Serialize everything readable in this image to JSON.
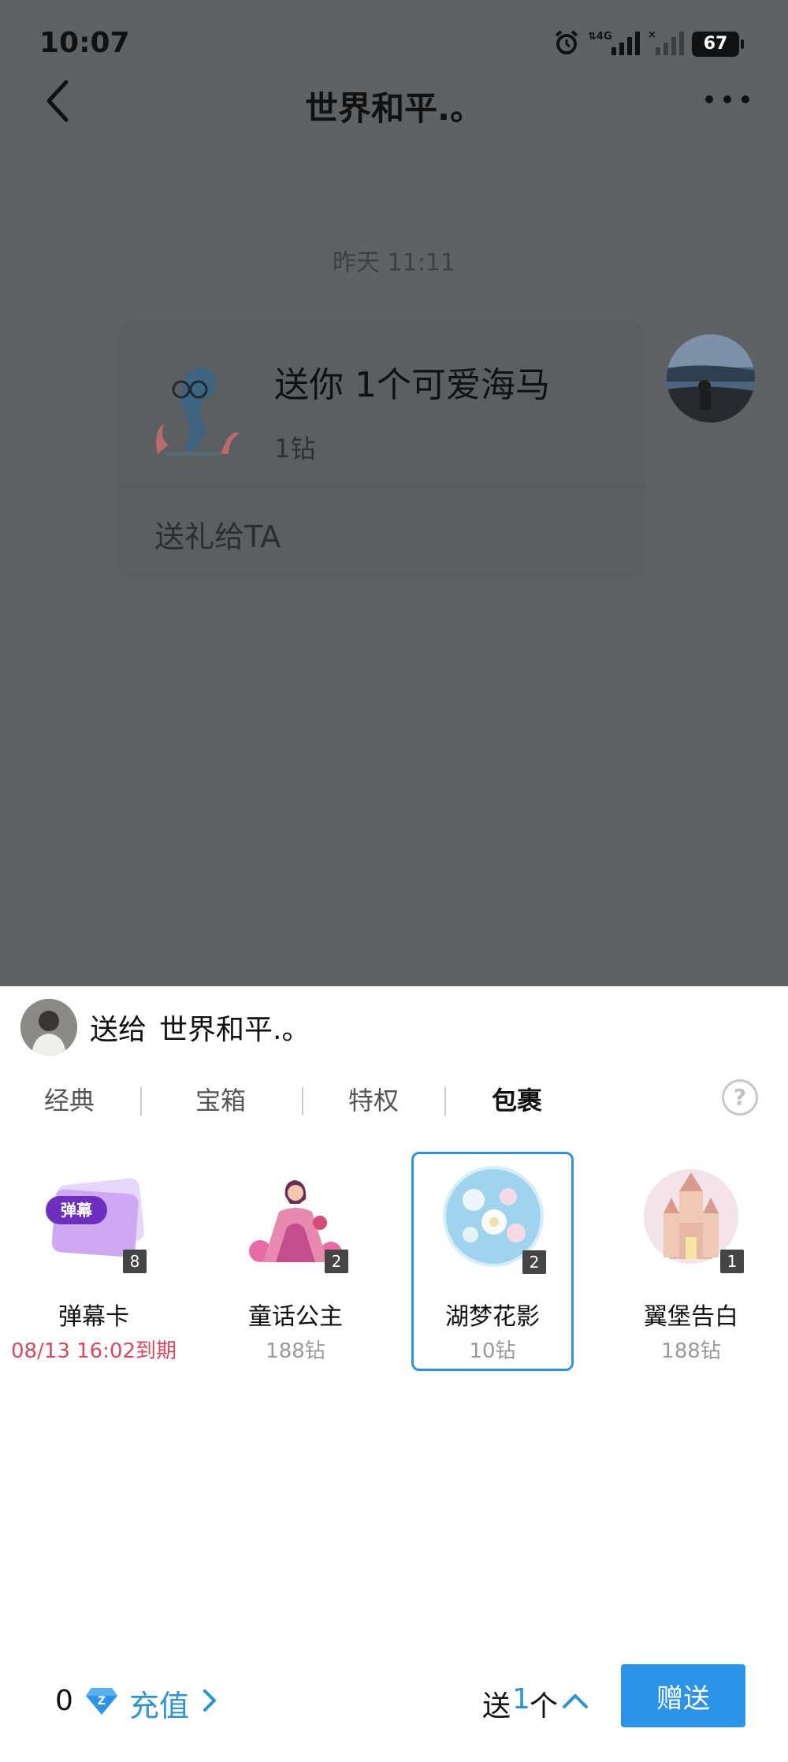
{
  "status_bar": {
    "time": "10:07",
    "network": "4G",
    "battery": "67"
  },
  "header": {
    "title": "世界和平.。"
  },
  "chat": {
    "timestamp": "昨天 11:11",
    "gift_card": {
      "title": "送你 1个可爱海马",
      "price": "1钻",
      "action": "送礼给TA"
    }
  },
  "sheet": {
    "send_to_label": "送给",
    "recipient_name": "世界和平.。",
    "tabs": [
      "经典",
      "宝箱",
      "特权",
      "包裹"
    ],
    "active_tab": "包裹",
    "gifts": [
      {
        "name": "弹幕卡",
        "sub": "08/13 16:02到期",
        "count": "8",
        "badge_text": "弹幕"
      },
      {
        "name": "童话公主",
        "sub": "188钻",
        "count": "2"
      },
      {
        "name": "湖梦花影",
        "sub": "10钻",
        "count": "2",
        "selected": true
      },
      {
        "name": "翼堡告白",
        "sub": "188钻",
        "count": "1"
      }
    ],
    "footer": {
      "balance": "0",
      "recharge_label": "充值",
      "qty_prefix": "送",
      "qty_value": "1",
      "qty_unit": "个",
      "send_label": "赠送"
    }
  },
  "colors": {
    "accent": "#2b93e8",
    "expire": "#d9475f",
    "overlay": "#5e6265"
  }
}
